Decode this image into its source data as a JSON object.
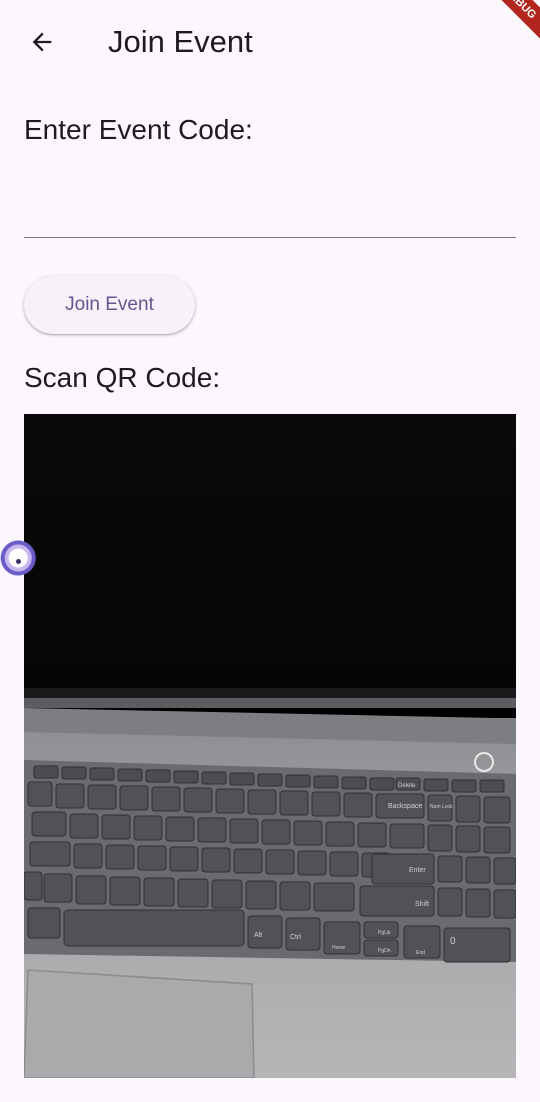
{
  "app_bar": {
    "title": "Join Event",
    "back_icon": "arrow-left-icon",
    "debug_banner": "DEBUG"
  },
  "event_code": {
    "label": "Enter Event Code:",
    "value": "",
    "placeholder": ""
  },
  "join_button": {
    "label": "Join Event"
  },
  "qr": {
    "label": "Scan QR Code:"
  },
  "keyboard_keys": {
    "delete": "Delete",
    "backspace": "Backspace",
    "num_lock": "Num Lock",
    "enter": "Enter",
    "shift": "Shift",
    "home": "Home",
    "end": "End",
    "alt": "Alt",
    "ctrl": "Ctrl",
    "pgup": "PgUp",
    "pgdn": "PgDn",
    "zero": "0"
  },
  "colors": {
    "background": "#fcf7fd",
    "accent": "#65558f",
    "banner": "#b3261e"
  }
}
